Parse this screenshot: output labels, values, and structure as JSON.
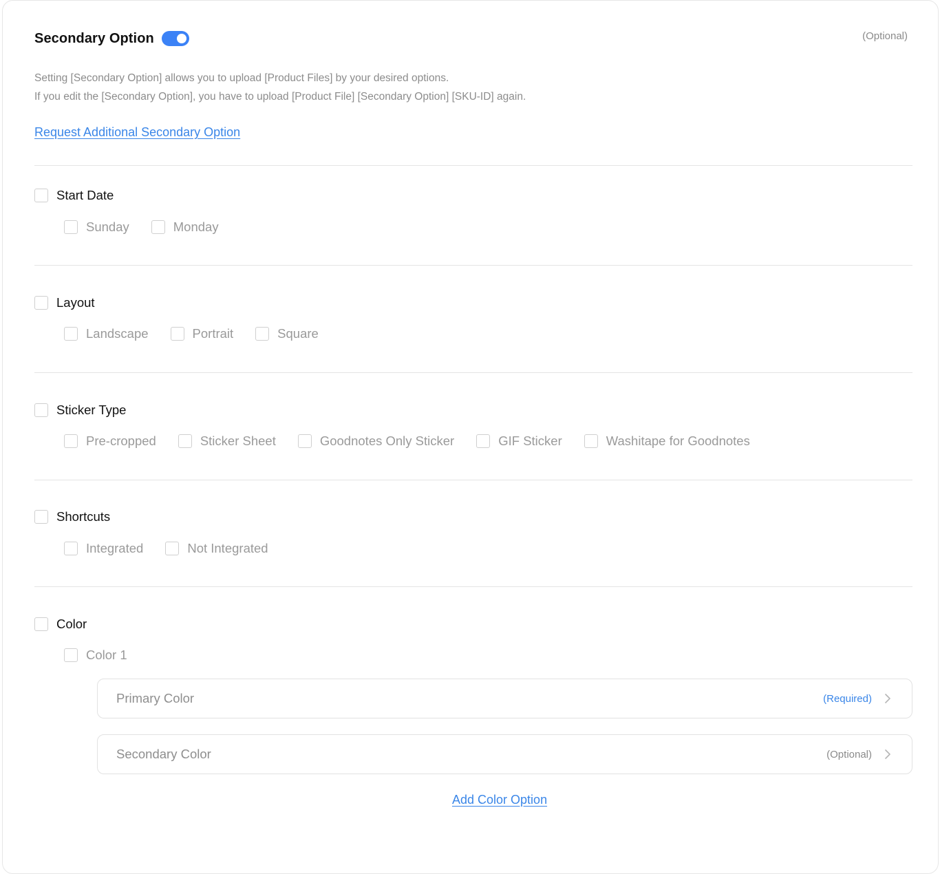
{
  "header": {
    "title": "Secondary Option",
    "toggle_on": true,
    "optional_label": "(Optional)"
  },
  "description": {
    "line1": "Setting [Secondary Option] allows you to upload [Product Files] by your desired options.",
    "line2": "If you edit the [Secondary Option], you have to upload [Product File] [Secondary Option] [SKU-ID] again."
  },
  "request_link": "Request Additional Secondary Option",
  "groups": [
    {
      "label": "Start Date",
      "checked": false,
      "options": [
        {
          "label": "Sunday",
          "checked": false
        },
        {
          "label": "Monday",
          "checked": false
        }
      ]
    },
    {
      "label": "Layout",
      "checked": false,
      "options": [
        {
          "label": "Landscape",
          "checked": false
        },
        {
          "label": "Portrait",
          "checked": false
        },
        {
          "label": "Square",
          "checked": false
        }
      ]
    },
    {
      "label": "Sticker Type",
      "checked": false,
      "options": [
        {
          "label": "Pre-cropped",
          "checked": false
        },
        {
          "label": "Sticker Sheet",
          "checked": false
        },
        {
          "label": "Goodnotes Only Sticker",
          "checked": false
        },
        {
          "label": "GIF Sticker",
          "checked": false
        },
        {
          "label": "Washitape for Goodnotes",
          "checked": false
        }
      ]
    },
    {
      "label": "Shortcuts",
      "checked": false,
      "options": [
        {
          "label": "Integrated",
          "checked": false
        },
        {
          "label": "Not Integrated",
          "checked": false
        }
      ]
    },
    {
      "label": "Color",
      "checked": false,
      "options": [
        {
          "label": "Color 1",
          "checked": false
        }
      ]
    }
  ],
  "color_fields": [
    {
      "label": "Primary Color",
      "tag": "(Required)"
    },
    {
      "label": "Secondary Color",
      "tag": "(Optional)"
    }
  ],
  "add_color_link": "Add Color Option",
  "colors": {
    "accent": "#3b82f6",
    "link": "#3a86e8",
    "border": "#e4e4e4"
  }
}
